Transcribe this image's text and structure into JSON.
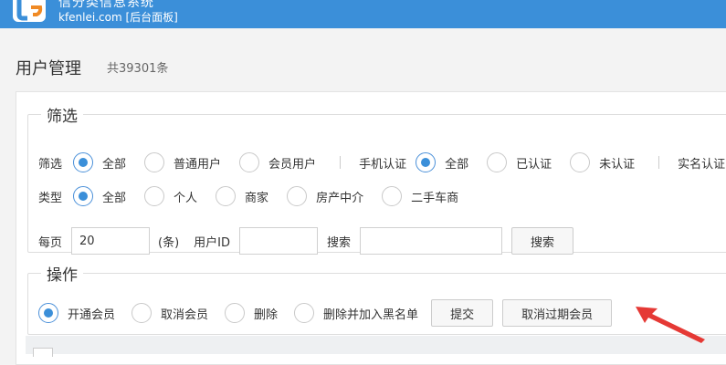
{
  "header": {
    "title": "信分类信息系统",
    "subtitle": "kfenlei.com [后台面板]"
  },
  "page": {
    "title": "用户管理",
    "count": "共39301条"
  },
  "filter": {
    "legend": "筛选",
    "row1": {
      "label": "筛选",
      "options": [
        "全部",
        "普通用户",
        "会员用户"
      ],
      "selected": "全部",
      "phone_label": "手机认证",
      "phone_options": [
        "全部",
        "已认证",
        "未认证"
      ],
      "phone_selected": "全部",
      "realname_label": "实名认证"
    },
    "row2": {
      "label": "类型",
      "options": [
        "全部",
        "个人",
        "商家",
        "房产中介",
        "二手车商"
      ],
      "selected": "全部"
    },
    "row3": {
      "per_page_label": "每页",
      "per_page_value": "20",
      "unit": "(条)",
      "userid_label": "用户ID",
      "userid_value": "",
      "search_label": "搜索",
      "search_value": "",
      "search_button": "搜索"
    }
  },
  "actions": {
    "legend": "操作",
    "options": [
      "开通会员",
      "取消会员",
      "删除",
      "删除并加入黑名单"
    ],
    "selected": "开通会员",
    "submit_button": "提交",
    "cancel_expired_button": "取消过期会员"
  },
  "colors": {
    "header_bg": "#3b8fd9",
    "radio_on": "#3b8fd9",
    "arrow": "#e53935"
  }
}
